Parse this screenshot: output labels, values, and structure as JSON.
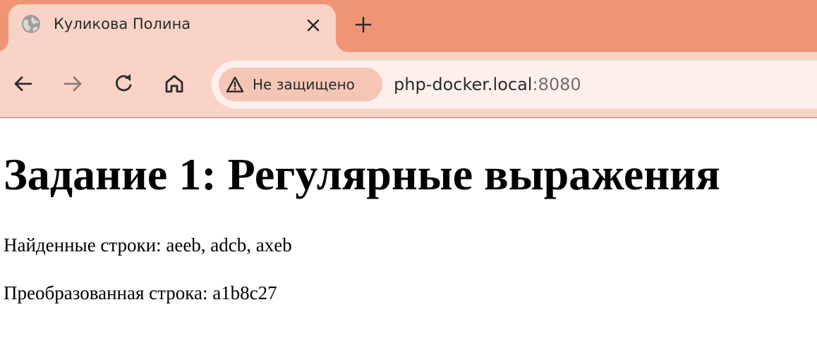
{
  "tab": {
    "title": "Куликова Полина",
    "favicon": "globe-icon"
  },
  "toolbar": {
    "security_label": "Не защищено",
    "url_host": "php-docker.local",
    "url_port": ":8080"
  },
  "page": {
    "title": "Задание 1: Регулярные выражения",
    "found_label": "Найденные строки: aeeb, adcb, axeb",
    "transformed_label": "Преобразованная строка: a1b8c27"
  },
  "colors": {
    "tabstrip": "#ef9575",
    "active_tab": "#f8d3c6",
    "omnibox": "#fdf0ec",
    "security_chip": "#f5c6b6"
  }
}
